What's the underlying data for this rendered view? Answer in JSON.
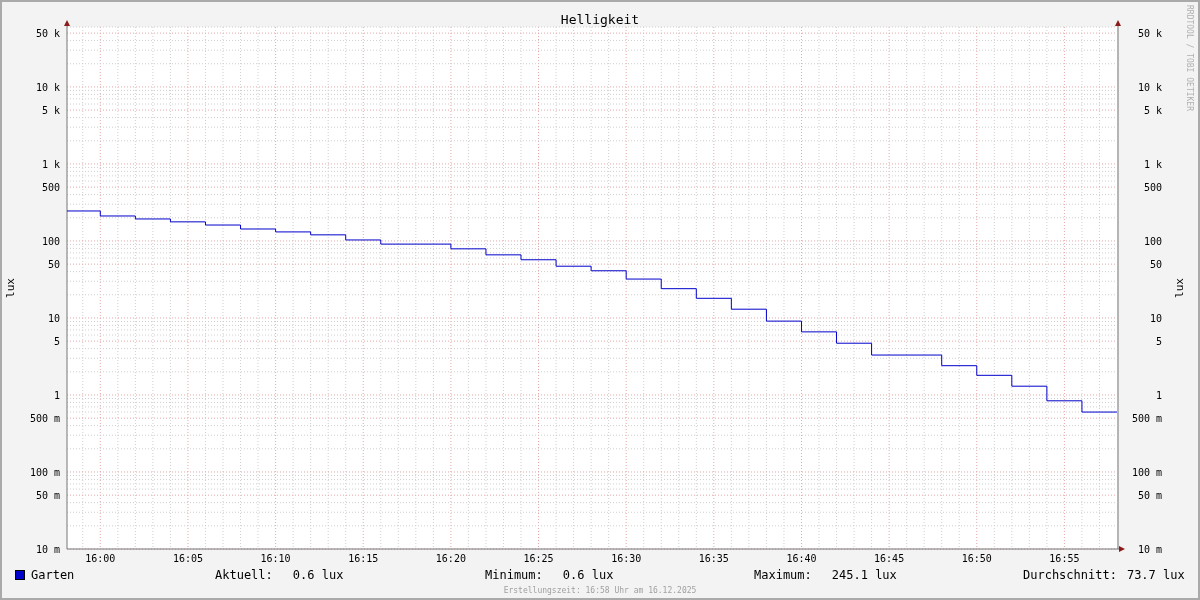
{
  "chart": {
    "title": "Helligkeit",
    "left_axis": {
      "ylabel": "lux",
      "yticks": [
        "50 k",
        "10 k",
        "5 k",
        "1 k",
        "500",
        "100",
        "50",
        "10",
        "5",
        "1",
        "500 m",
        "100 m",
        "50 m",
        "10 m"
      ]
    },
    "right_axis": {
      "ylabel": "lux",
      "yticks": [
        "50 k",
        "10 k",
        "5 k",
        "1 k",
        "500",
        "100",
        "50",
        "10",
        "5",
        "1",
        "500 m",
        "100 m",
        "50 m",
        "10 m"
      ]
    },
    "xticks": [
      "16:00",
      "16:05",
      "16:10",
      "16:15",
      "16:20",
      "16:25",
      "16:30",
      "16:35",
      "16:40",
      "16:45",
      "16:50",
      "16:55"
    ],
    "credit": "RRDTOOL / TOBI OETIKER"
  },
  "legend": {
    "series": {
      "name": "Garten",
      "color": "#0000cc"
    },
    "stats": [
      {
        "label": "Aktuell:",
        "value": "0.6 lux"
      },
      {
        "label": "Minimum:",
        "value": "0.6 lux"
      },
      {
        "label": "Maximum:",
        "value": "245.1 lux"
      },
      {
        "label": "Durchschnitt:",
        "value": "73.7 lux"
      }
    ]
  },
  "footer": "Erstellungszeit: 16:58 Uhr am 16.12.2025"
}
